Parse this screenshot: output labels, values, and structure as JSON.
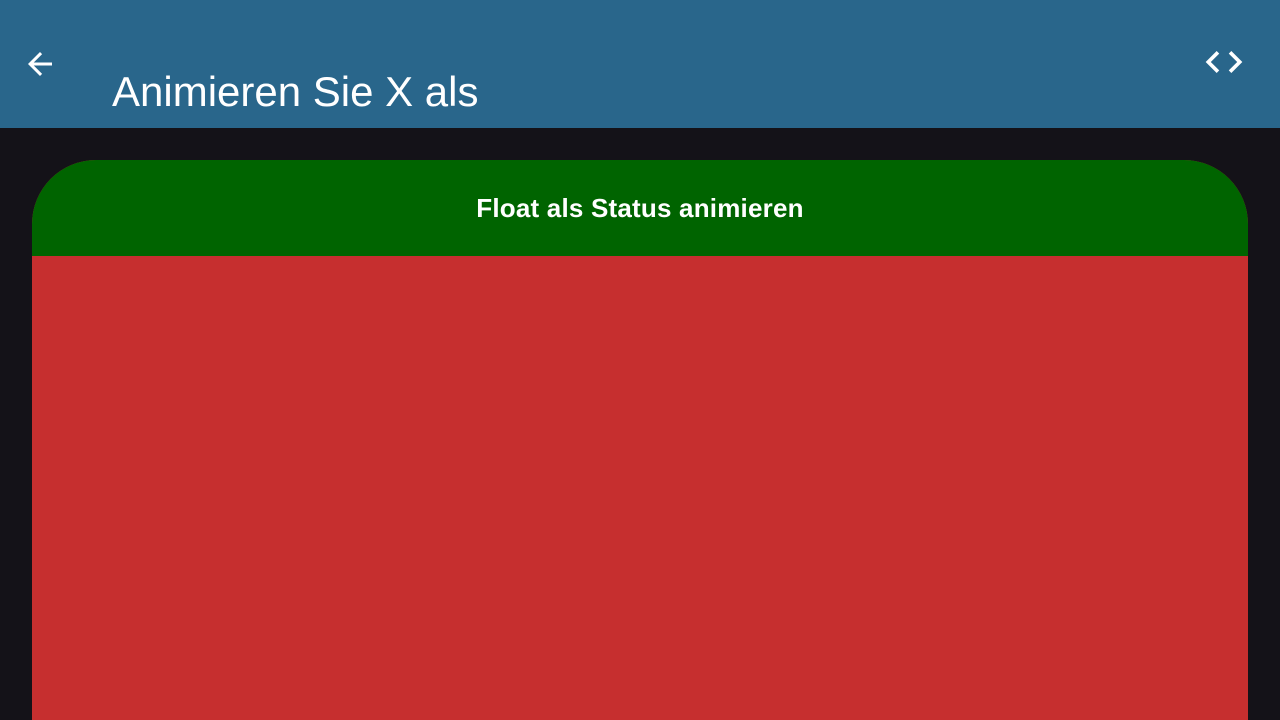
{
  "app_bar": {
    "title": "Animieren Sie X als",
    "back_icon": "arrow-back-icon",
    "code_icon": "code-icon",
    "background": "#29668b"
  },
  "card": {
    "header_label": "Float als Status animieren",
    "header_color": "#006400",
    "animated_area_color": "#c62f2f"
  },
  "page": {
    "background": "#141218"
  }
}
